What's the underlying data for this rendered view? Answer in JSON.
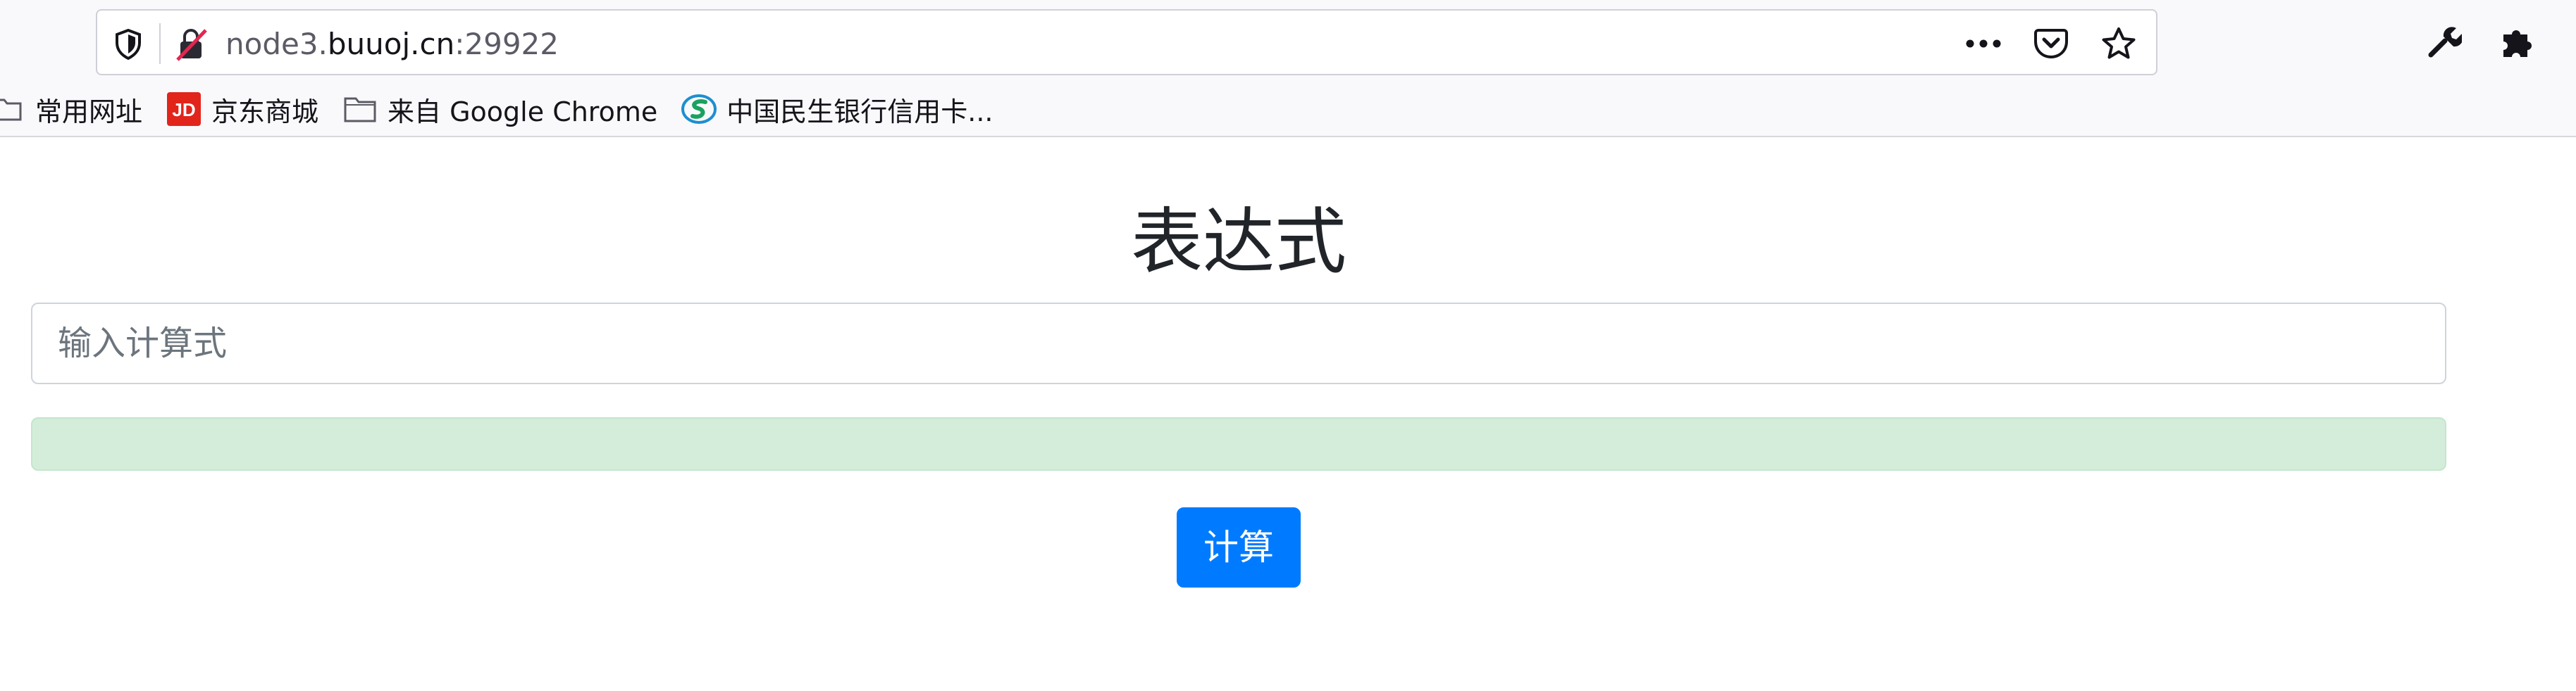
{
  "browser": {
    "url_prefix": "node3.",
    "url_host": "buuoj.cn",
    "url_suffix": ":29922"
  },
  "bookmarks": [
    {
      "label": "常用网址",
      "icon": "folder-icon"
    },
    {
      "label": "京东商城",
      "icon": "jd-icon"
    },
    {
      "label": "来自 Google Chrome",
      "icon": "folder-icon"
    },
    {
      "label": "中国民生银行信用卡...",
      "icon": "cmbc-icon"
    }
  ],
  "page": {
    "title": "表达式",
    "input_placeholder": "输入计算式",
    "input_value": "",
    "result_text": "",
    "submit_label": "计算"
  },
  "colors": {
    "primary": "#007bff",
    "alert_bg": "#d4edda",
    "alert_border": "#c3e6cb"
  }
}
